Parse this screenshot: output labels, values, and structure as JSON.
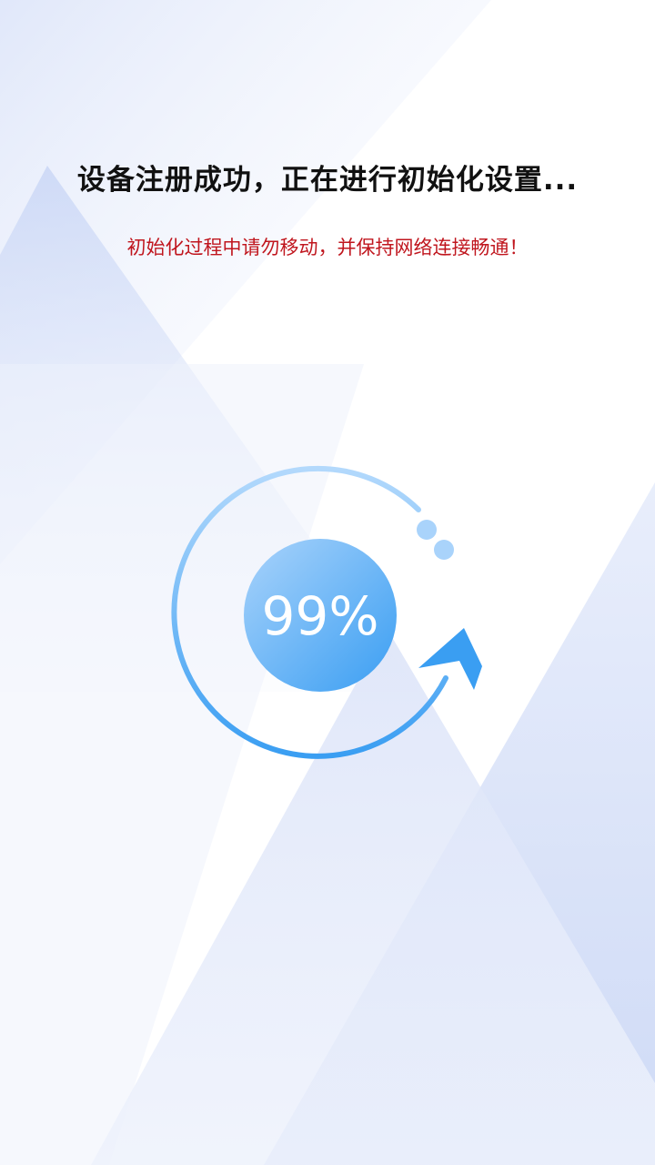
{
  "status": {
    "title": "设备注册成功，正在进行初始化设置...",
    "warning": "初始化过程中请勿移动，并保持网络连接畅通！"
  },
  "progress": {
    "percent_label": "99%",
    "value": 0.99
  },
  "colors": {
    "title": "#111111",
    "warning": "#c0161e",
    "progress_light": "#a9d3fb",
    "progress_dark": "#3a9ef2",
    "background_tint": "#c9d5f4"
  },
  "icons": {
    "progress_ring": "circular-arrow-icon"
  }
}
